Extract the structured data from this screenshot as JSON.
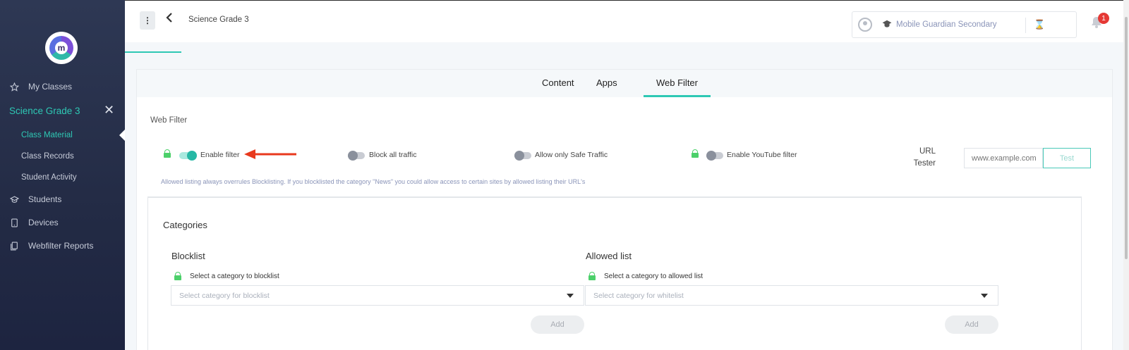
{
  "sidebar": {
    "logo_letter": "m",
    "items": [
      {
        "label": "My Classes",
        "icon": "star-icon"
      },
      {
        "label": "Students",
        "icon": "graduation-cap-icon"
      },
      {
        "label": "Devices",
        "icon": "tablet-icon"
      },
      {
        "label": "Webfilter Reports",
        "icon": "reports-icon"
      }
    ],
    "active_class": "Science Grade 3",
    "sub_items": [
      "Class Material",
      "Class Records",
      "Student Activity"
    ],
    "active_sub": "Class Material"
  },
  "header": {
    "breadcrumb": "Science Grade 3",
    "user_name": "Mobile Guardian Secondary",
    "notification_count": "1"
  },
  "tabs": [
    {
      "label": "Content",
      "active": false
    },
    {
      "label": "Apps",
      "active": false
    },
    {
      "label": "Web Filter",
      "active": true
    }
  ],
  "webfilter": {
    "title": "Web Filter",
    "options": [
      {
        "label": "Enable filter",
        "on": true,
        "locked": true
      },
      {
        "label": "Block all traffic",
        "on": false,
        "locked": false
      },
      {
        "label": "Allow only Safe Traffic",
        "on": false,
        "locked": false
      },
      {
        "label": "Enable YouTube filter",
        "on": false,
        "locked": true
      }
    ],
    "url_tester_label_1": "URL",
    "url_tester_label_2": "Tester",
    "url_placeholder": "www.example.com",
    "test_button": "Test",
    "note": "Allowed listing always overrules Blocklisting. If you blocklisted the category \"News\" you could allow access to certain sites by allowed listing their URL's"
  },
  "categories": {
    "title": "Categories",
    "blocklist": {
      "title": "Blocklist",
      "select_label": "Select a category to blocklist",
      "placeholder": "Select category for blocklist",
      "add_button": "Add"
    },
    "allowed": {
      "title": "Allowed list",
      "select_label": "Select a category to allowed list",
      "placeholder": "Select category for whitelist",
      "add_button": "Add"
    }
  },
  "colors": {
    "accent": "#2ec8b4",
    "sidebar_bg": "#2a3350",
    "lock_green": "#4cd06a",
    "arrow_red": "#e8391d",
    "badge_red": "#e53935"
  }
}
